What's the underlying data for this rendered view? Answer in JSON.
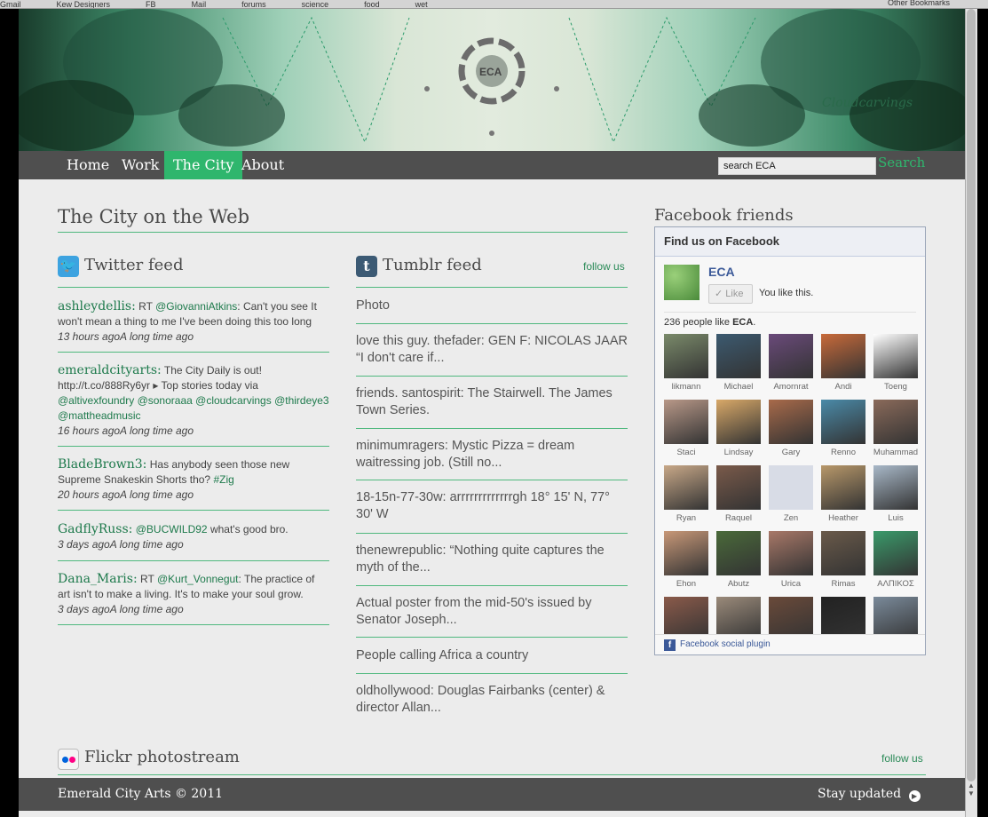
{
  "browser": {
    "bookmarks": [
      "Gmail",
      "Kew Designers",
      "FB",
      "Mail",
      "forums",
      "science",
      "food",
      "wet",
      "Other Bookmarks"
    ]
  },
  "banner": {
    "logo_text": "ECA",
    "signature": "Cloudcarvings"
  },
  "nav": {
    "items": [
      {
        "label": "Home",
        "active": false
      },
      {
        "label": "Work",
        "active": false
      },
      {
        "label": "The City",
        "active": true
      },
      {
        "label": "About",
        "active": false
      }
    ],
    "search_value": "search ECA",
    "search_button": "Search"
  },
  "main": {
    "title": "The City on the Web"
  },
  "twitter": {
    "title": "Twitter feed",
    "tweets": [
      {
        "user": "ashleydellis:",
        "parts": [
          {
            "t": "RT ",
            "l": false
          },
          {
            "t": "@GiovanniAtkins",
            "l": true
          },
          {
            "t": ": Can't you see It won't mean a thing to me I've been doing this too long",
            "l": false
          }
        ],
        "time": "13 hours agoA long time ago"
      },
      {
        "user": "emeraldcityarts:",
        "parts": [
          {
            "t": "The City Daily is out! http://t.co/888Ry6yr ▸ Top stories today via ",
            "l": false
          },
          {
            "t": "@altivexfoundry",
            "l": true
          },
          {
            "t": " ",
            "l": false
          },
          {
            "t": "@sonoraaa",
            "l": true
          },
          {
            "t": " ",
            "l": false
          },
          {
            "t": "@cloudcarvings",
            "l": true
          },
          {
            "t": " ",
            "l": false
          },
          {
            "t": "@thirdeye3",
            "l": true
          },
          {
            "t": " ",
            "l": false
          },
          {
            "t": "@mattheadmusic",
            "l": true
          }
        ],
        "time": "16 hours agoA long time ago"
      },
      {
        "user": "BladeBrown3:",
        "parts": [
          {
            "t": "Has anybody seen those new Supreme Snakeskin Shorts tho? ",
            "l": false
          },
          {
            "t": "#Zig",
            "l": true
          }
        ],
        "time": "20 hours agoA long time ago"
      },
      {
        "user": "GadflyRuss:",
        "parts": [
          {
            "t": "@BUCWILD92",
            "l": true
          },
          {
            "t": " what's good bro.",
            "l": false
          }
        ],
        "time": "3 days agoA long time ago"
      },
      {
        "user": "Dana_Maris:",
        "parts": [
          {
            "t": "RT ",
            "l": false
          },
          {
            "t": "@Kurt_Vonnegut",
            "l": true
          },
          {
            "t": ": The practice of art isn't to make a living. It's to make your soul grow.",
            "l": false
          }
        ],
        "time": "3 days agoA long time ago"
      }
    ]
  },
  "tumblr": {
    "title": "Tumblr feed",
    "follow": "follow us",
    "items": [
      "Photo",
      "love this guy.  thefader: GEN F: NICOLAS JAAR “I don't care if...",
      "friends. santospirit: The Stairwell. The James Town Series.",
      "minimumragers: Mystic Pizza = dream waitressing job. (Still no...",
      "18-15n-77-30w: arrrrrrrrrrrrrgh 18° 15' N, 77° 30' W",
      "thenewrepublic: “Nothing quite captures the myth of the...",
      "Actual poster from the mid-50's issued by Senator Joseph...",
      "People calling Africa a country",
      "oldhollywood: Douglas Fairbanks (center) & director Allan..."
    ]
  },
  "facebook": {
    "title": "Facebook friends",
    "box_header": "Find us on Facebook",
    "page_name": "ECA",
    "like_button": "Like",
    "you_like": "You like this.",
    "count_prefix": "236 people like ",
    "count_page": "ECA",
    "count_suffix": ".",
    "friends": [
      {
        "name": "likmann",
        "color": "#7a8a6a"
      },
      {
        "name": "Michael",
        "color": "#3c5a70"
      },
      {
        "name": "Amornrat",
        "color": "#6a4a7a"
      },
      {
        "name": "Andi",
        "color": "#c86a3a"
      },
      {
        "name": "Toeng",
        "color": "#ffffff"
      },
      {
        "name": "Staci",
        "color": "#b89888"
      },
      {
        "name": "Lindsay",
        "color": "#d8a868"
      },
      {
        "name": "Gary",
        "color": "#a86a4a"
      },
      {
        "name": "Renno",
        "color": "#4a8aa8"
      },
      {
        "name": "Muhammad",
        "color": "#8a6a5a"
      },
      {
        "name": "Ryan",
        "color": "#c8a888"
      },
      {
        "name": "Raquel",
        "color": "#7a5a4a"
      },
      {
        "name": "Zen",
        "color": "#d8dce6"
      },
      {
        "name": "Heather",
        "color": "#b8986a"
      },
      {
        "name": "Luis",
        "color": "#a8b8c8"
      },
      {
        "name": "Ehon",
        "color": "#c89878"
      },
      {
        "name": "Abutz",
        "color": "#4a6a3a"
      },
      {
        "name": "Urica",
        "color": "#a87868"
      },
      {
        "name": "Rimas",
        "color": "#6a5a4a"
      },
      {
        "name": "ΑΛΠΙΚΟΣ",
        "color": "#3a9a6a"
      },
      {
        "name": "",
        "color": "#8a5a4a"
      },
      {
        "name": "",
        "color": "#9a8a7a"
      },
      {
        "name": "",
        "color": "#6a4a3a"
      },
      {
        "name": "",
        "color": "#222222"
      },
      {
        "name": "",
        "color": "#7a8a9a"
      }
    ],
    "plugin_label": "Facebook social plugin"
  },
  "flickr": {
    "title": "Flickr photostream",
    "follow": "follow us"
  },
  "footer": {
    "copyright": "Emerald City Arts © 2011",
    "stay_updated": "Stay updated"
  },
  "colors": {
    "accent": "#2fb66d",
    "nav_bg": "#4f4f4f",
    "page_bg": "#ececec",
    "link": "#1e7a4c"
  }
}
